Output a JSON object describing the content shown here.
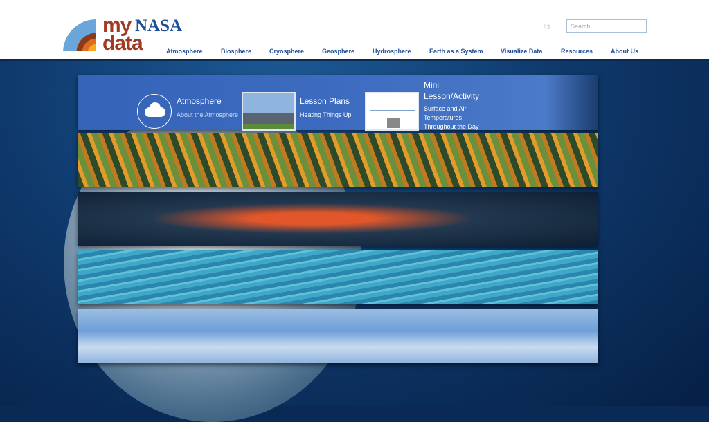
{
  "header": {
    "logo": {
      "line1a": "my",
      "line1b": "NASA",
      "line2": "data"
    },
    "nav": [
      {
        "label": "Atmosphere"
      },
      {
        "label": "Biosphere"
      },
      {
        "label": "Cryosphere"
      },
      {
        "label": "Geosphere"
      },
      {
        "label": "Hydrosphere"
      },
      {
        "label": "Earth as a System"
      },
      {
        "label": "Visualize Data"
      },
      {
        "label": "Resources"
      },
      {
        "label": "About Us"
      }
    ],
    "search": {
      "placeholder": "Search",
      "value": ""
    },
    "share_icon": "share-icon"
  },
  "hero": {
    "cards": [
      {
        "title": "Atmosphere",
        "subtitle": "About the Atmosphere",
        "icon": "cloud-icon"
      },
      {
        "title": "Lesson Plans",
        "subtitle": "Heating Things Up"
      },
      {
        "title": "Mini Lesson/Activity",
        "subtitle": "Surface and Air Temperatures Throughout the Day"
      }
    ]
  },
  "colors": {
    "brand_blue": "#1f4e9a",
    "brand_red": "#a33a22",
    "hero_bg": "#0f3a6d"
  }
}
